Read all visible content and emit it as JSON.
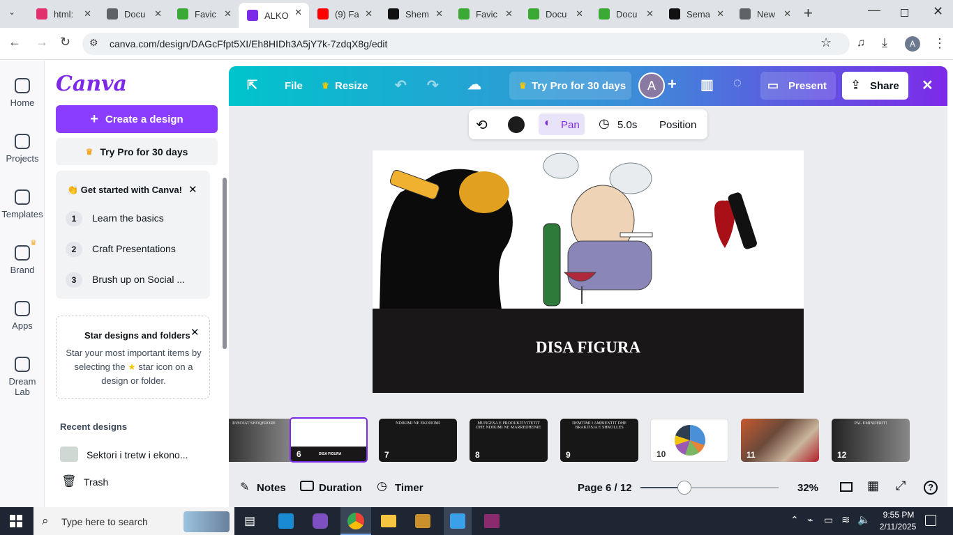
{
  "browser": {
    "tabs": [
      {
        "title": "html:",
        "icon": "instagram-icon",
        "color": "#e1306c"
      },
      {
        "title": "Docu",
        "icon": "globe-icon",
        "color": "#5f6368"
      },
      {
        "title": "Favic",
        "icon": "favicon-icon",
        "color": "#3ba935"
      },
      {
        "title": "ALKO",
        "icon": "canva-icon",
        "color": "#7d2ae8",
        "active": true
      },
      {
        "title": "(9) Fa",
        "icon": "youtube-icon",
        "color": "#ff0000"
      },
      {
        "title": "Shem",
        "icon": "chatgpt-icon",
        "color": "#111111"
      },
      {
        "title": "Favic",
        "icon": "favicon-icon",
        "color": "#3ba935"
      },
      {
        "title": "Docu",
        "icon": "favicon-icon",
        "color": "#3ba935"
      },
      {
        "title": "Docu",
        "icon": "favicon-icon",
        "color": "#3ba935"
      },
      {
        "title": "Sema",
        "icon": "chatgpt-icon",
        "color": "#111111"
      },
      {
        "title": "New",
        "icon": "chrome-icon",
        "color": "#5f6368"
      }
    ],
    "url": "canva.com/design/DAGcFfpt5XI/Eh8HIDh3A5jY7k-7zdqX8g/edit",
    "profile_initial": "A"
  },
  "rail": [
    {
      "label": "Home",
      "icon": "home-icon"
    },
    {
      "label": "Projects",
      "icon": "folder-icon"
    },
    {
      "label": "Templates",
      "icon": "templates-icon"
    },
    {
      "label": "Brand",
      "icon": "brand-icon"
    },
    {
      "label": "Apps",
      "icon": "apps-icon"
    },
    {
      "label": "Dream Lab",
      "icon": "dream-lab-icon"
    }
  ],
  "panel": {
    "logo": "Canva",
    "create_label": "Create a design",
    "try_pro_label": "Try Pro for 30 days",
    "get_started": {
      "title": "👏 Get started with Canva!",
      "items": [
        {
          "num": "1",
          "label": "Learn the basics"
        },
        {
          "num": "2",
          "label": "Craft Presentations"
        },
        {
          "num": "3",
          "label": "Brush up on Social ..."
        }
      ]
    },
    "star": {
      "title": "Star designs and folders",
      "body_before": "Star your most important items by selecting the",
      "body_after": "star icon on a design or folder."
    },
    "recent_title": "Recent designs",
    "recent_item": "Sektori i tretw i ekono...",
    "trash_label": "Trash"
  },
  "topbar": {
    "file": "File",
    "resize": "Resize",
    "try_pro": "Try Pro for 30 days",
    "avatar": "A",
    "present": "Present",
    "share": "Share"
  },
  "context": {
    "pan": "Pan",
    "duration": "5.0s",
    "position": "Position"
  },
  "slide": {
    "title": "DISA FIGURA"
  },
  "thumbs": [
    {
      "num": "",
      "caption": "PASOJAT SHOQERORE",
      "theme": "gray"
    },
    {
      "num": "6",
      "caption": "DISA FIGURA",
      "theme": "current"
    },
    {
      "num": "7",
      "caption": "NDIKIMI NE EKONOMI",
      "theme": "dark"
    },
    {
      "num": "8",
      "caption": "MUNGESA E PRODUKTIVITETIT DHE NDIKIMI NE MARREDHENIE",
      "theme": "dark"
    },
    {
      "num": "9",
      "caption": "DEMTIMI I AMBIENTIT DHE BRAKTISJA E SHKOLLES",
      "theme": "dark"
    },
    {
      "num": "10",
      "caption": "",
      "theme": "pie"
    },
    {
      "num": "11",
      "caption": "",
      "theme": "photos"
    },
    {
      "num": "12",
      "caption": "PAL EMINDERIT!",
      "theme": "gray"
    }
  ],
  "bottombar": {
    "notes": "Notes",
    "duration": "Duration",
    "timer": "Timer",
    "page": "Page 6 / 12",
    "zoom": "32%",
    "zoom_fraction": 0.32
  },
  "taskbar": {
    "search_placeholder": "Type here to search",
    "time": "9:55 PM",
    "date": "2/11/2025"
  }
}
